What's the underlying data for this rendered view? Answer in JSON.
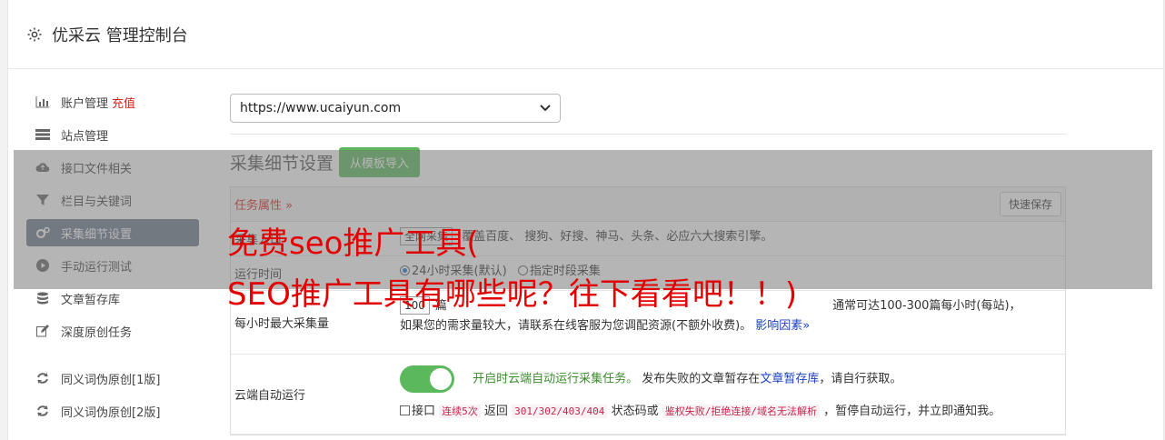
{
  "header": {
    "title": "优采云 管理控制台",
    "icon": "gear-icon"
  },
  "sidebar": {
    "items": [
      {
        "label": "账户管理",
        "badge": "充值",
        "icon": "bar-chart-icon"
      },
      {
        "label": "站点管理",
        "icon": "server-icon"
      },
      {
        "label": "接口文件相关",
        "icon": "cloud-upload-icon"
      },
      {
        "label": "栏目与关键词",
        "icon": "filter-icon"
      },
      {
        "label": "采集细节设置",
        "icon": "gears-icon",
        "active": true
      },
      {
        "label": "手动运行测试",
        "icon": "play-circle-icon"
      },
      {
        "label": "文章暂存库",
        "icon": "database-icon"
      },
      {
        "label": "深度原创任务",
        "icon": "edit-icon"
      }
    ],
    "items2": [
      {
        "label": "同义词伪原创[1版]",
        "icon": "refresh-icon"
      },
      {
        "label": "同义词伪原创[2版]",
        "icon": "refresh-icon"
      }
    ]
  },
  "main": {
    "site_select": "https://www.ucaiyun.com",
    "section_title": "采集细节设置",
    "import_button": "从模板导入",
    "panel_attr": "任务属性 »",
    "save_button": "快速保存",
    "rows": {
      "source": {
        "label": "采集入口",
        "select": "全网采集",
        "text1": "覆盖百度、",
        "text2": "搜狗、好搜、神马、头条、必应六大搜索引擎。"
      },
      "runtime": {
        "label": "运行时间",
        "opt1": "24小时采集(默认)",
        "opt2": "指定时段采集"
      },
      "maxcount": {
        "label": "每小时最大采集量",
        "value": "100",
        "unit": "篇",
        "text": "通常可达100-300篇每小时(每站)，",
        "line2": "如果您的需求量较大，请联系在线客服为您调配资源(不额外收费)。",
        "link": "影响因素»"
      },
      "cloud": {
        "label": "云端自动运行",
        "green": "开启时云端自动运行采集任务。",
        "text": "发布失败的文章暂存在",
        "link": "文章暂存库",
        "text2": "，请自行获取。",
        "chk_label": "接口",
        "code1": "连续5次",
        "t3": "返回",
        "code2": "301/302/403/404",
        "t4": "状态码或",
        "code3": "鉴权失败/拒绝连接/域名无法解析",
        "t5": "，暂停自动运行，并立即通知我。"
      }
    }
  },
  "overlay": {
    "line1": "免费seo推广工具(",
    "line2": "SEO推广工具有哪些呢？往下看看吧！！)"
  },
  "colors": {
    "accent_green": "#5cb85c",
    "active_item": "#6d7a8c",
    "promo_red": "#e30000"
  }
}
